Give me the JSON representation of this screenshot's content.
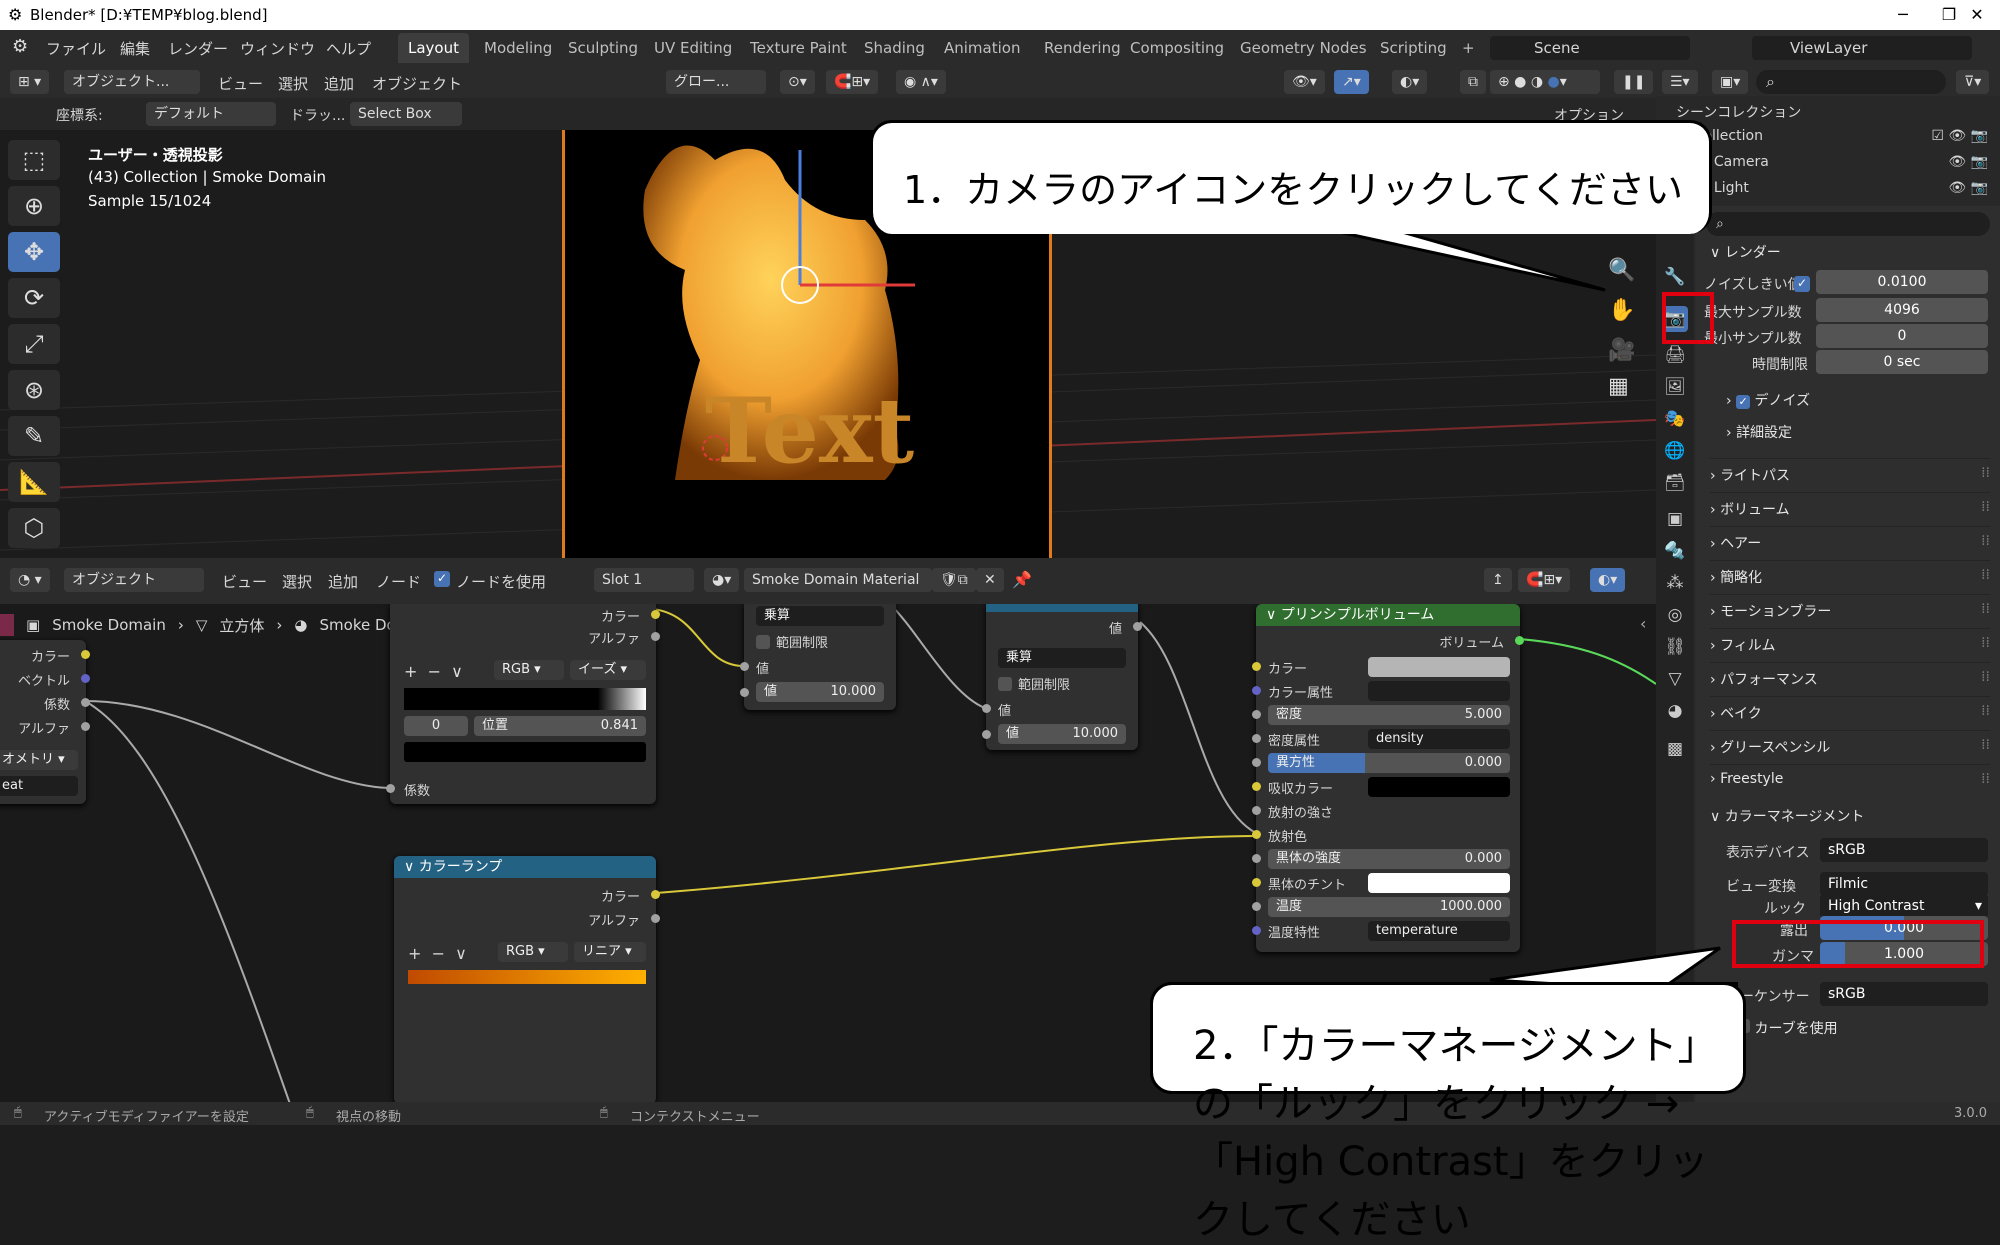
{
  "window": {
    "title": "Blender* [D:¥TEMP¥blog.blend]",
    "min": "─",
    "max": "❐",
    "close": "✕"
  },
  "menu": [
    "ファイル",
    "編集",
    "レンダー",
    "ウィンドウ",
    "ヘルプ"
  ],
  "workspaces": [
    "Layout",
    "Modeling",
    "Sculpting",
    "UV Editing",
    "Texture Paint",
    "Shading",
    "Animation",
    "Rendering",
    "Compositing",
    "Geometry Nodes",
    "Scripting"
  ],
  "workspace_add": "+",
  "scene": "Scene",
  "viewlayer": "ViewLayer",
  "viewport_header": {
    "mode": "オブジェクト...",
    "view": "ビュー",
    "select": "選択",
    "add": "追加",
    "object": "オブジェクト",
    "transform": "グロー...",
    "options": "オプション"
  },
  "viewport_header2": {
    "coord_label": "座標系:",
    "coord_value": "デフォルト",
    "drag": "ドラッ...",
    "select_box": "Select Box"
  },
  "viewport_info": {
    "line1": "ユーザー・透視投影",
    "line2": "(43) Collection | Smoke Domain",
    "line3": "Sample 15/1024",
    "text_object": "Text"
  },
  "node_header": {
    "mode": "オブジェクト",
    "view": "ビュー",
    "select": "選択",
    "add": "追加",
    "node": "ノード",
    "use_nodes": "ノードを使用",
    "slot": "Slot 1",
    "material": "Smoke Domain Material"
  },
  "breadcrumb": [
    "Smoke Domain",
    "立方体",
    "Smoke Domain Material"
  ],
  "nodes": {
    "attr": {
      "out": [
        "カラー",
        "ベクトル",
        "係数",
        "アルファ"
      ],
      "field": "オメトリ",
      "val": "eat"
    },
    "ramp1": {
      "outs": [
        "カラー",
        "アルファ"
      ],
      "mode": "RGB",
      "interp": "イーズ",
      "index": "0",
      "pos_label": "位置",
      "pos": "0.841",
      "in": "係数"
    },
    "math1": {
      "op": "乗算",
      "clamp": "範囲制限",
      "in": "値",
      "val_label": "値",
      "val": "10.000"
    },
    "math2": {
      "title": "乗算",
      "out": "値",
      "op": "乗算",
      "clamp": "範囲制限",
      "in": "値",
      "val_label": "値",
      "val": "10.000"
    },
    "ramp2": {
      "title": "カラーランプ",
      "outs": [
        "カラー",
        "アルファ"
      ],
      "mode": "RGB",
      "interp": "リニア"
    },
    "pvol": {
      "title": "プリンシプルボリューム",
      "out": "ボリューム",
      "rows": [
        {
          "label": "カラー",
          "value": ""
        },
        {
          "label": "カラー属性",
          "value": ""
        },
        {
          "label": "密度",
          "value": "5.000"
        },
        {
          "label": "密度属性",
          "value": "density"
        },
        {
          "label": "異方性",
          "value": "0.000"
        },
        {
          "label": "吸収カラー",
          "value": ""
        },
        {
          "label": "放射の強さ",
          "value": ""
        },
        {
          "label": "放射色",
          "value": ""
        },
        {
          "label": "黒体の強度",
          "value": "0.000"
        },
        {
          "label": "黒体のチント",
          "value": ""
        },
        {
          "label": "温度",
          "value": "1000.000"
        },
        {
          "label": "温度特性",
          "value": "temperature"
        }
      ]
    }
  },
  "outliner": {
    "title": "シーンコレクション",
    "items": [
      "Collection",
      "Camera",
      "Light"
    ]
  },
  "props": {
    "render_section": "レンダー",
    "noise_label": "ノイズしきい値",
    "noise": "0.0100",
    "max_samples_label": "最大サンプル数",
    "max_samples": "4096",
    "min_samples_label": "最小サンプル数",
    "min_samples": "0",
    "time_label": "時間制限",
    "time": "0 sec",
    "denoise": "デノイズ",
    "advanced": "詳細設定",
    "sections": [
      "ライトパス",
      "ボリューム",
      "ヘアー",
      "簡略化",
      "モーションブラー",
      "フィルム",
      "パフォーマンス",
      "ベイク",
      "グリースペンシル",
      "Freestyle"
    ],
    "cm_section": "カラーマネージメント",
    "display_label": "表示デバイス",
    "display": "sRGB",
    "view_label": "ビュー変換",
    "view": "Filmic",
    "look_label": "ルック",
    "look": "High Contrast",
    "exposure_label": "露出",
    "exposure": "0.000",
    "gamma_label": "ガンマ",
    "gamma": "1.000",
    "sequencer_label": "シーケンサー",
    "sequencer": "sRGB",
    "curves": "カーブを使用"
  },
  "status": {
    "left": "アクティブモディファイアーを設定",
    "mid": "視点の移動",
    "ctx": "コンテクストメニュー",
    "version": "3.0.0"
  },
  "callouts": {
    "one": "1．カメラのアイコンをクリックしてください",
    "two": "2．「カラーマネージメント」の「ルック」をクリック →「High Contrast」をクリックしてください"
  },
  "colors": {
    "accent": "#4772b3",
    "highlight": "#e00010",
    "fire": "#f0a030"
  }
}
